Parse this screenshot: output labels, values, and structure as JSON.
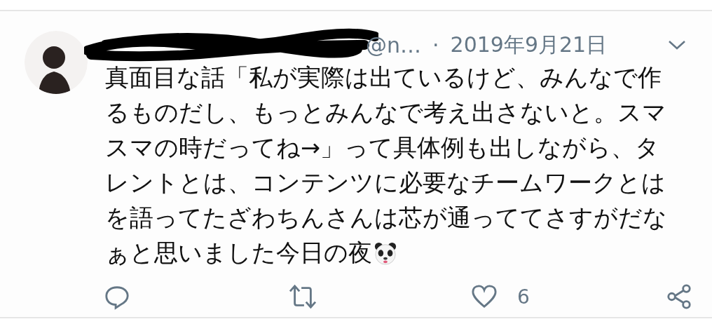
{
  "tweet": {
    "handle": "@n…",
    "separator": "·",
    "date": "2019年9月21日",
    "text": "真面目な話「私が実際は出ているけど、みんなで作るものだし、もっとみんなで考え出さないと。スマスマの時だってね→」って具体例も出しながら、タレントとは、コンテンツに必要なチームワークとはを語ってたざわちんさんは芯が通っててさすがだな",
    "text_end": "ぁと思いました今日の夜",
    "actions": [
      {
        "kind": "reply"
      },
      {
        "kind": "retweet"
      },
      {
        "kind": "like",
        "count": "6"
      },
      {
        "kind": "share"
      }
    ]
  }
}
